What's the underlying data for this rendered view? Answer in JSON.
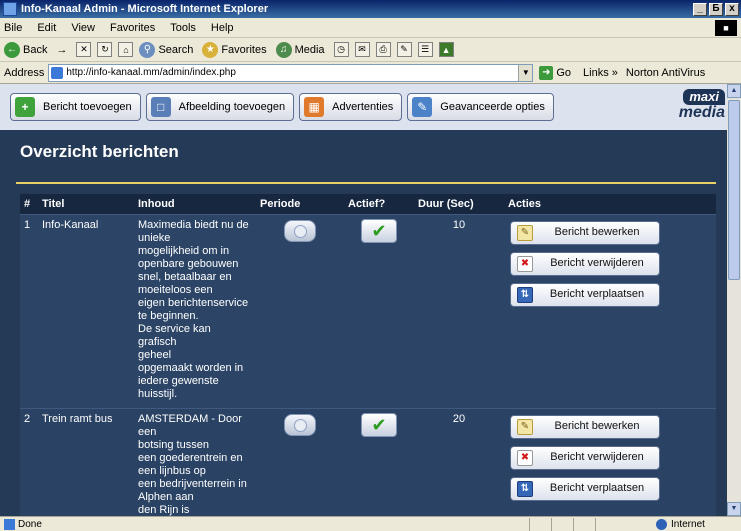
{
  "window": {
    "title": "Info-Kanaal Admin - Microsoft Internet Explorer",
    "controls": [
      "_",
      "Б",
      "x"
    ]
  },
  "menu": {
    "items": [
      "Bile",
      "Edit",
      "View",
      "Favorites",
      "Tools",
      "Help"
    ]
  },
  "toolbar": {
    "back": "Back",
    "forward": "→",
    "search": "Search",
    "favorites": "Favorites",
    "media": "Media"
  },
  "address": {
    "label": "Address",
    "url": "http://info-kanaal.mm/admin/index.php",
    "go": "Go",
    "links": "Links »",
    "norton": "Norton AntiVirus"
  },
  "admin_nav": {
    "buttons": [
      {
        "label": "Bericht toevoegen",
        "icon": "add-icon",
        "color": "#3FA23A"
      },
      {
        "label": "Afbeelding toevoegen",
        "icon": "image-icon",
        "color": "#5A7FB8"
      },
      {
        "label": "Advertenties",
        "icon": "advert-icon",
        "color": "#E07A2C"
      },
      {
        "label": "Geavanceerde opties",
        "icon": "options-icon",
        "color": "#4B82C8"
      }
    ],
    "logo_top": "maxi",
    "logo_bottom": "media"
  },
  "page": {
    "title": "Overzicht berichten"
  },
  "table": {
    "headers": [
      "#",
      "Titel",
      "Inhoud",
      "Periode",
      "Actief?",
      "Duur (Sec)",
      "Acties"
    ],
    "rows": [
      {
        "num": "1",
        "titel": "Info-Kanaal",
        "inhoud": "Maximedia biedt nu de\nunieke\nmogelijkheid om in\nopenbare gebouwen\nsnel, betaalbaar en\nmoeiteloos een\neigen berichtenservice\nte beginnen.\nDe service kan grafisch\ngeheel\nopgemaakt worden in\niedere gewenste\nhuisstijl.",
        "duur": "10"
      },
      {
        "num": "2",
        "titel": "Trein ramt bus",
        "inhoud": "AMSTERDAM - Door een\nbotsing tussen\neen goederentrein en\neen lijnbus op\neen bedrijventerrein in\nAlphen aan\nden Rijn is",
        "duur": "20"
      }
    ],
    "actions": {
      "edit": "Bericht bewerken",
      "delete": "Bericht verwijderen",
      "move": "Bericht verplaatsen"
    }
  },
  "status": {
    "text": "Done",
    "zone": "Internet"
  },
  "colors": {
    "page_bg": "#253A56",
    "header_bg": "#17273F",
    "accent_rule": "#E8D066",
    "check": "#2E9B21"
  }
}
